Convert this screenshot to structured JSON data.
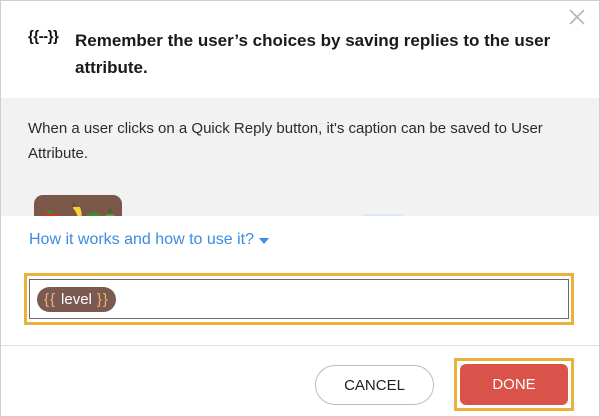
{
  "dialog": {
    "title_icon": "{{--}}",
    "title": "Remember the user’s choices by saving replies to the user attribute.",
    "close_icon": "close-icon"
  },
  "body": {
    "description": "When a user clicks on a Quick Reply button, it's caption can be saved to User Attribute.",
    "preview_image": "fruit-emoji-preview"
  },
  "help": {
    "link_label": "How it works and how to use it?"
  },
  "attribute_field": {
    "chip_open": "{{",
    "chip_label": "level",
    "chip_close": "}}"
  },
  "footer": {
    "cancel_label": "CANCEL",
    "done_label": "DONE"
  },
  "colors": {
    "accent_highlight": "#eab23a",
    "done_button": "#d9534a",
    "link": "#3b8be0",
    "chip_bg": "#7b5b51",
    "chip_brace": "#f0b36e"
  }
}
